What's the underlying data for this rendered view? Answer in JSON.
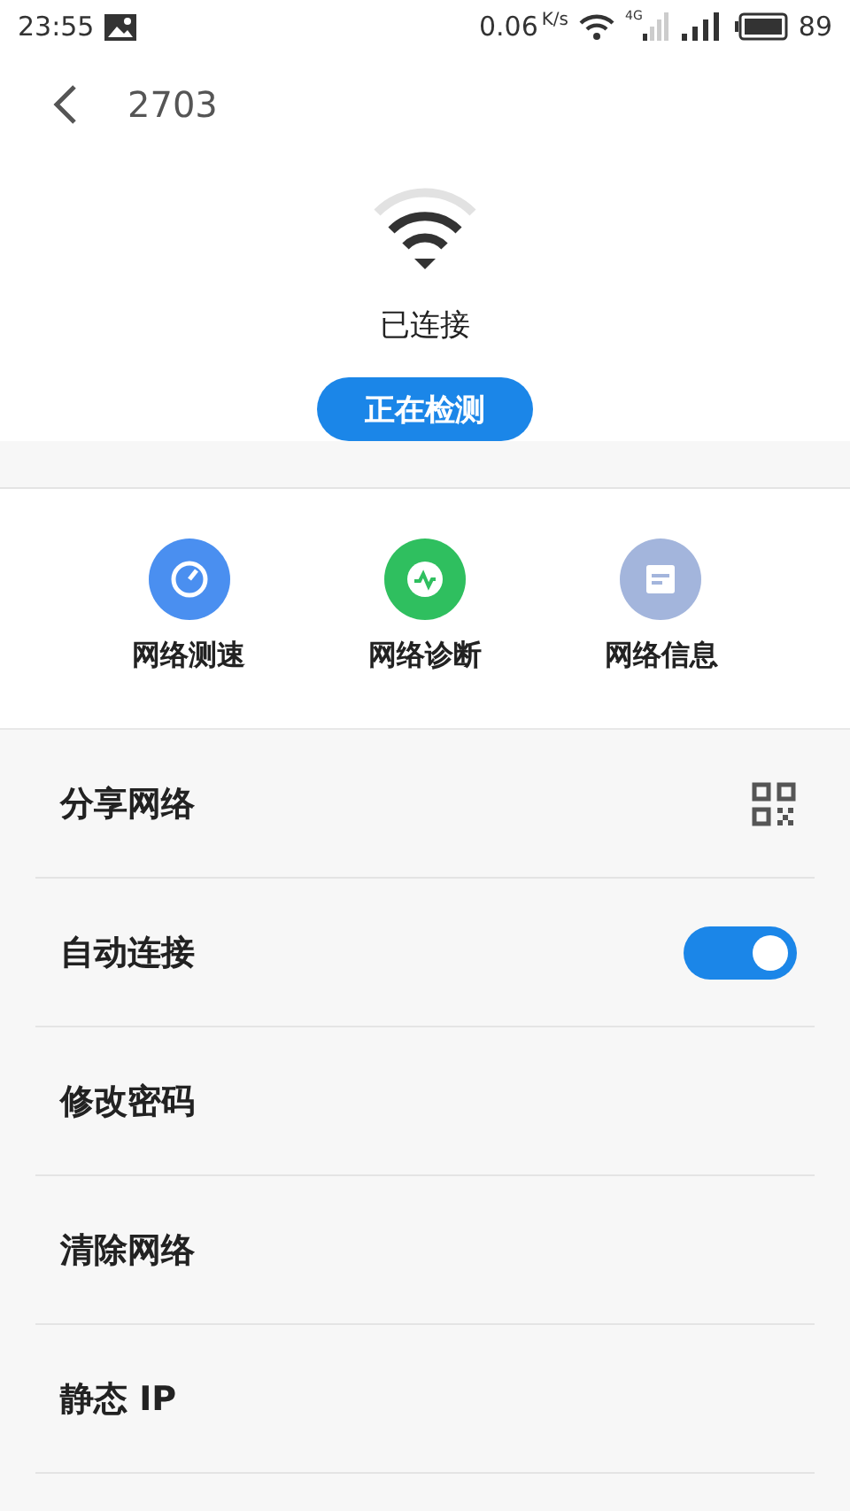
{
  "status_bar": {
    "time": "23:55",
    "speed": "0.06",
    "speed_unit": "K/s",
    "network_type": "4G",
    "battery": "89"
  },
  "header": {
    "title": "2703"
  },
  "connection": {
    "status": "已连接",
    "button": "正在检测"
  },
  "tools": [
    {
      "label": "网络测速",
      "color": "#4a8ff0",
      "kind": "gauge"
    },
    {
      "label": "网络诊断",
      "color": "#2fbf5f",
      "kind": "pulse"
    },
    {
      "label": "网络信息",
      "color": "#a3b5dc",
      "kind": "doc"
    }
  ],
  "settings": [
    {
      "label": "分享网络",
      "kind": "qr"
    },
    {
      "label": "自动连接",
      "kind": "toggle",
      "on": true
    },
    {
      "label": "修改密码",
      "kind": "plain"
    },
    {
      "label": "清除网络",
      "kind": "plain"
    },
    {
      "label": "静态 IP",
      "kind": "plain"
    }
  ]
}
